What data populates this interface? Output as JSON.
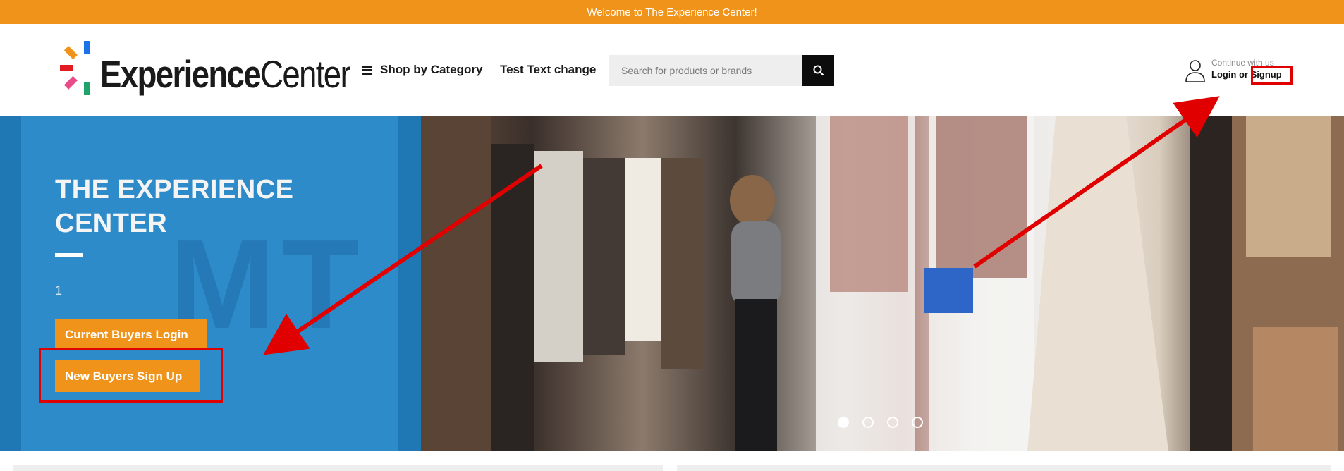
{
  "topbar": {
    "welcome": "Welcome to The Experience Center!"
  },
  "logo": {
    "part1": "Experience",
    "part2": "Center",
    "colors": [
      "#f0931b",
      "#1a73e8",
      "#e31b23",
      "#e84d8a",
      "#1fa36b"
    ]
  },
  "nav": {
    "category_label": "Shop by Category",
    "test_link": "Test Text change"
  },
  "search": {
    "placeholder": "Search for products or brands",
    "icon": "search-icon"
  },
  "account": {
    "continue_text": "Continue with us",
    "login_text": "Login or Signup",
    "icon": "person-icon"
  },
  "hero": {
    "title": "THE EXPERIENCE CENTER",
    "slide_number": "1",
    "current_buyers_button": "Current Buyers Login",
    "new_buyers_button": "New Buyers Sign Up",
    "slides_total": 4,
    "active_slide": 1
  },
  "colors": {
    "accent": "#f0931b",
    "hero_blue": "#2e8bc9",
    "annotation_red": "#e00000"
  }
}
